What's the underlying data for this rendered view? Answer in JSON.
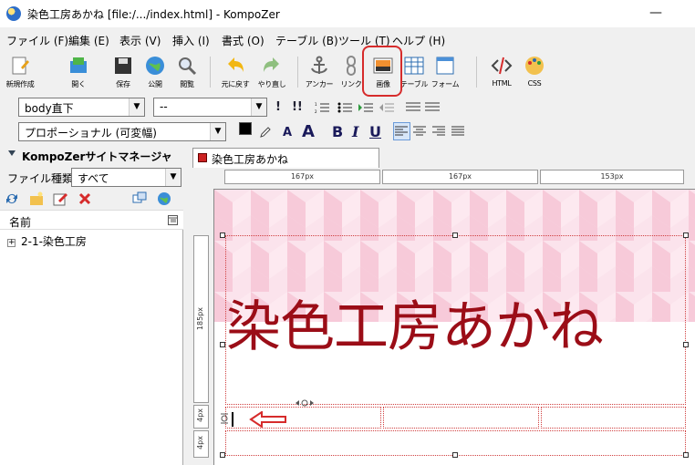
{
  "window": {
    "title": "染色工房あかね [file:/.../index.html] - KompoZer",
    "minimize_glyph": "—"
  },
  "menu": [
    "ファイル (F)",
    "編集 (E)",
    "表示 (V)",
    "挿入 (I)",
    "書式 (O)",
    "テーブル (B)",
    "ツール (T)",
    "ヘルプ (H)"
  ],
  "toolbar": {
    "new": "新規作成",
    "open": "開く",
    "save": "保存",
    "publish": "公開",
    "browse": "閲覧",
    "undo": "元に戻す",
    "redo": "やり直し",
    "anchor": "アンカー",
    "link": "リンク",
    "image": "画像",
    "table": "テーブル",
    "form": "フォーム",
    "html": "HTML",
    "css": "CSS"
  },
  "format_bar": {
    "paragraph_select": "body直下",
    "class_select": "--",
    "font_select": "プロポーショナル (可変幅)",
    "bold": "B",
    "italic": "I",
    "underline": "U"
  },
  "site_manager": {
    "title": "KompoZerサイトマネージャ",
    "file_type_label": "ファイル種類:",
    "file_type_value": "すべて",
    "column_name": "名前",
    "tree_item": "2-1-染色工房"
  },
  "editor": {
    "tab_title": "染色工房あかね",
    "ruler_cols": [
      "167px",
      "167px",
      "153px"
    ],
    "row_heights": [
      "185px",
      "4px",
      "4px"
    ],
    "heading": "染色工房あかね"
  },
  "colors": {
    "accent_red": "#d62b2b",
    "heading": "#9b0d17",
    "pattern_pink": "#f7cad9"
  }
}
